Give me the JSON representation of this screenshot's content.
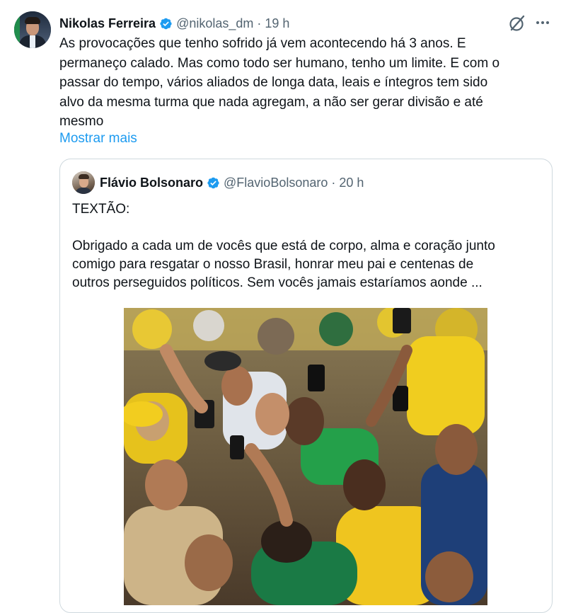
{
  "tweet": {
    "author_name": "Nikolas Ferreira",
    "handle": "@nikolas_dm",
    "separator": "·",
    "time": "19 h",
    "text_lines": [
      "As provocações que tenho sofrido já vem acontecendo há 3 anos. E",
      "permaneço calado. Mas como todo ser humano, tenho um limite. E com o",
      "passar do tempo, vários aliados de longa data, leais e íntegros tem sido",
      "alvo da mesma turma que nada agregam, a não ser gerar divisão e até",
      "mesmo"
    ],
    "show_more": "Mostrar mais"
  },
  "quote": {
    "author_name": "Flávio Bolsonaro",
    "handle": "@FlavioBolsonaro",
    "separator": "·",
    "time": "20 h",
    "text_lines": [
      "TEXTÃO:",
      "",
      "Obrigado a cada um de vocês que está de corpo, alma e coração junto",
      "comigo para resgatar o nosso Brasil, honrar meu pai e centenas de",
      "outros perseguidos políticos. Sem vocês jamais estaríamos aonde ..."
    ]
  },
  "icons": {
    "verified": "verified-badge-icon",
    "grok": "grok-icon",
    "more": "more-options-icon"
  },
  "colors": {
    "accent": "#1d9bf0",
    "secondary_text": "#536471",
    "border": "#cfd9de",
    "brazil_green": "#1a9a48",
    "brazil_yellow": "#f4d21c"
  }
}
